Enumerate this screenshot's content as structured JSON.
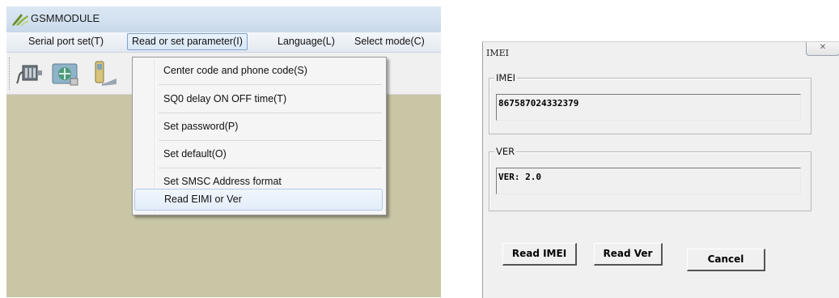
{
  "app": {
    "title": "GSMMODULE",
    "menu": [
      {
        "label": "Serial port set(T)"
      },
      {
        "label": "Read or set parameter(I)"
      },
      {
        "label": "Language(L)"
      },
      {
        "label": "Select mode(C)"
      }
    ],
    "toolbar_icons": [
      "serial-port-icon",
      "network-settings-icon",
      "phone-icon"
    ],
    "dropdown": [
      {
        "label": "Center code and phone code(S)"
      },
      {
        "label": "SQ0 delay ON OFF time(T)"
      },
      {
        "label": "Set password(P)"
      },
      {
        "label": "Set default(O)"
      },
      {
        "label": "Set SMSC Address format"
      },
      {
        "label": "Read EIMI or Ver"
      }
    ],
    "colors": {
      "client_area": "#c9c6a6",
      "menu_highlight": "#e3edf9"
    }
  },
  "dialog": {
    "title": "IMEI",
    "close_glyph": "✕",
    "imei": {
      "group_label": "IMEI",
      "value": "867587024332379"
    },
    "ver": {
      "group_label": "VER",
      "value": "VER: 2.0"
    },
    "buttons": {
      "read_imei": "Read IMEI",
      "read_ver": "Read Ver",
      "cancel": "Cancel"
    }
  }
}
